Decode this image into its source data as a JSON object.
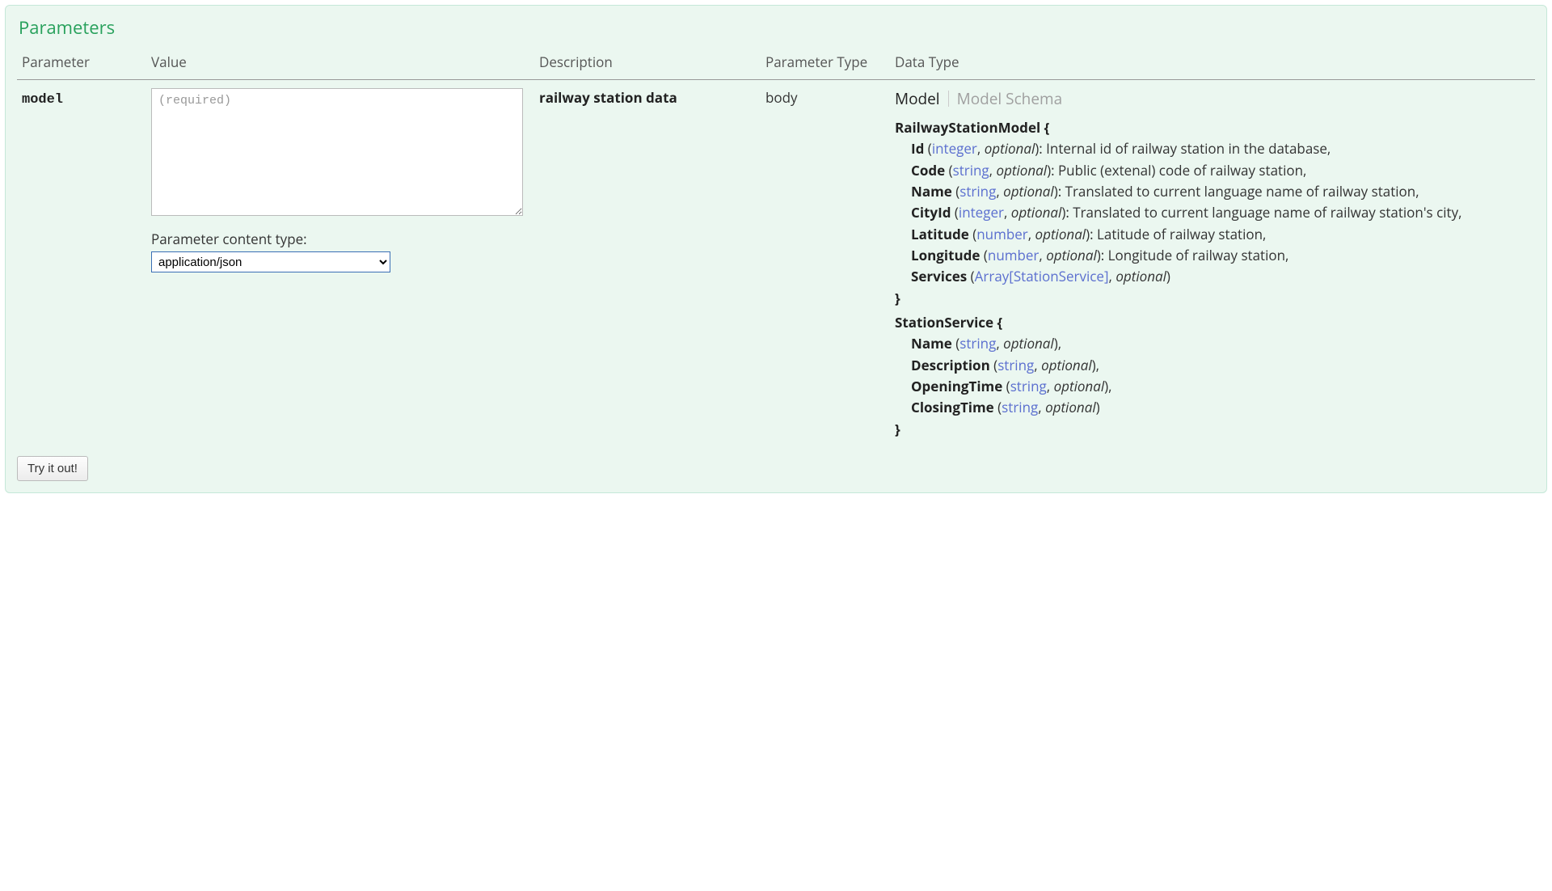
{
  "section_title": "Parameters",
  "columns": {
    "parameter": "Parameter",
    "value": "Value",
    "description": "Description",
    "parameter_type": "Parameter Type",
    "data_type": "Data Type"
  },
  "row": {
    "name": "model",
    "textarea_placeholder": "(required)",
    "textarea_value": "",
    "content_type_label": "Parameter content type:",
    "content_type_value": "application/json",
    "content_type_options": [
      "application/json"
    ],
    "description": "railway station data",
    "parameter_type": "body"
  },
  "tabs": {
    "model": "Model",
    "schema": "Model Schema",
    "active": "model"
  },
  "model": {
    "RailwayStationModel": {
      "open": "RailwayStationModel {",
      "close": "}",
      "props": [
        {
          "name": "Id",
          "type": "integer",
          "optional": "optional",
          "desc": ": Internal id of railway station in the database,",
          "trailing": ""
        },
        {
          "name": "Code",
          "type": "string",
          "optional": "optional",
          "desc": ": Public (extenal) code of railway station,",
          "trailing": ""
        },
        {
          "name": "Name",
          "type": "string",
          "optional": "optional",
          "desc": ": Translated to current language name of railway station,",
          "trailing": ""
        },
        {
          "name": "CityId",
          "type": "integer",
          "optional": "optional",
          "desc": ": Translated to current language name of railway station's city,",
          "trailing": ""
        },
        {
          "name": "Latitude",
          "type": "number",
          "optional": "optional",
          "desc": ": Latitude of railway station,",
          "trailing": ""
        },
        {
          "name": "Longitude",
          "type": "number",
          "optional": "optional",
          "desc": ": Longitude of railway station,",
          "trailing": ""
        },
        {
          "name": "Services",
          "type": "Array[StationService]",
          "optional": "optional",
          "desc": "",
          "trailing": ""
        }
      ]
    },
    "StationService": {
      "open": "StationService {",
      "close": "}",
      "props": [
        {
          "name": "Name",
          "type": "string",
          "optional": "optional",
          "desc": "",
          "trailing": ","
        },
        {
          "name": "Description",
          "type": "string",
          "optional": "optional",
          "desc": "",
          "trailing": ","
        },
        {
          "name": "OpeningTime",
          "type": "string",
          "optional": "optional",
          "desc": "",
          "trailing": ","
        },
        {
          "name": "ClosingTime",
          "type": "string",
          "optional": "optional",
          "desc": "",
          "trailing": ""
        }
      ]
    }
  },
  "try_button": "Try it out!"
}
